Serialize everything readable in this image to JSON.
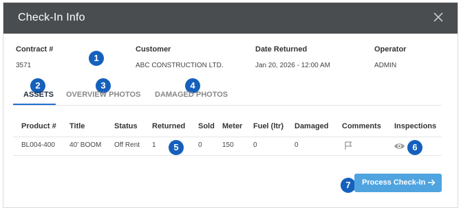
{
  "dialog": {
    "title": "Check-In Info"
  },
  "fields": {
    "contract": {
      "label": "Contract #",
      "value": "3571"
    },
    "customer": {
      "label": "Customer",
      "value": "ABC CONSTRUCTION LTD."
    },
    "date_returned": {
      "label": "Date Returned",
      "value": "Jan 20, 2026 - 12:00 AM"
    },
    "operator": {
      "label": "Operator",
      "value": "ADMIN"
    }
  },
  "tabs": [
    {
      "label": "ASSETS",
      "active": true
    },
    {
      "label": "OVERVIEW PHOTOS",
      "active": false
    },
    {
      "label": "DAMAGED PHOTOS",
      "active": false
    }
  ],
  "table": {
    "headers": [
      "Product #",
      "Title",
      "Status",
      "Returned",
      "Sold",
      "Meter",
      "Fuel (ltr)",
      "Damaged",
      "Comments",
      "Inspections"
    ],
    "rows": [
      {
        "product": "BL004-400",
        "title": "40' BOOM",
        "status": "Off Rent",
        "returned": "1",
        "sold": "0",
        "meter": "150",
        "fuel": "0",
        "damaged": "0"
      }
    ]
  },
  "actions": {
    "process_label": "Process Check-In"
  },
  "annotations": [
    "1",
    "2",
    "3",
    "4",
    "5",
    "6",
    "7"
  ],
  "colors": {
    "header_bg": "#4a4d50",
    "badge": "#1560bd",
    "tab_active_underline": "#1f6fd1",
    "button_bg": "#4fa4e0"
  }
}
